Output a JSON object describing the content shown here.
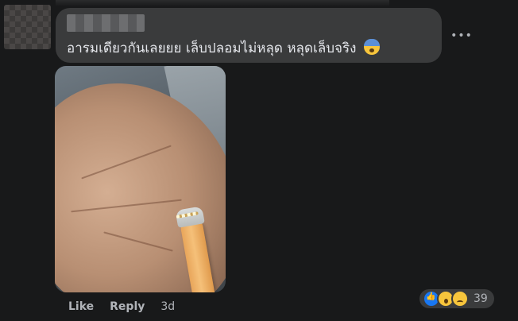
{
  "comment": {
    "text": "อารมเดียวกันเลยยย เล็บปลอมไม่หลุด หลุดเล็บจริง"
  },
  "icons": {
    "emoji": "anxious-face-with-sweat-icon",
    "more": "more-options-icon",
    "reactions": [
      "like-icon",
      "wow-icon",
      "sad-icon"
    ]
  },
  "actions": {
    "like_label": "Like",
    "reply_label": "Reply",
    "time": "3d"
  },
  "reactions": {
    "count": "39"
  },
  "colors": {
    "background": "#18191a",
    "bubble": "#3a3b3c",
    "text": "#e4e6eb",
    "secondary_text": "#b0b3b8",
    "like_blue": "#1877f2"
  }
}
